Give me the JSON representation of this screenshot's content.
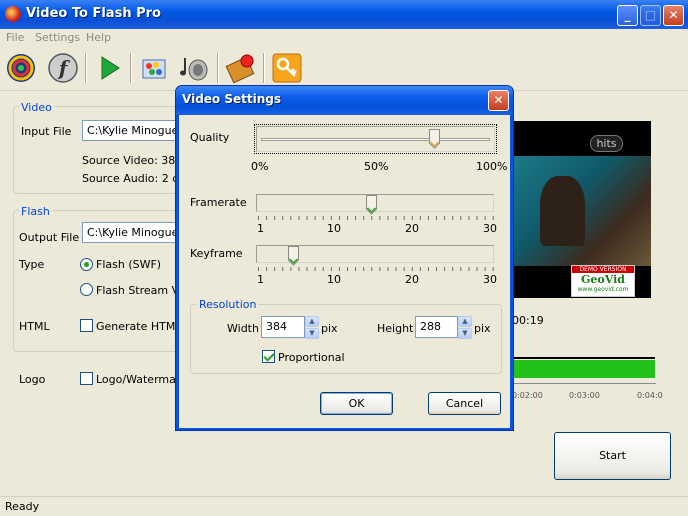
{
  "app": {
    "title": "Video To Flash Pro"
  },
  "menu": [
    "File",
    "Settings",
    "Help"
  ],
  "toolbar": {
    "icons": [
      "open-video-icon",
      "flash-icon",
      "play-icon",
      "color-palette-icon",
      "audio-speaker-icon",
      "film-effects-icon",
      "key-register-icon"
    ]
  },
  "video_group": {
    "label": "Video",
    "input_file_label": "Input File",
    "input_file_value": "C:\\Kylie Minogue -",
    "source_video": "Source Video: 384x",
    "source_audio": "Source Audio: 2 cha"
  },
  "flash_group": {
    "label": "Flash",
    "output_file_label": "Output File",
    "output_file_value": "C:\\Kylie Minogue -",
    "type_label": "Type",
    "type_options": [
      "Flash (SWF)",
      "Flash Stream Vid"
    ],
    "type_selected": 0,
    "html_label": "HTML",
    "generate_html": "Generate HTML",
    "generate_html_checked": false
  },
  "logo": {
    "label": "Logo",
    "checkbox_label": "Logo/Watermark",
    "checked": false
  },
  "preview": {
    "badge": "hits",
    "demo_text": "DEMO VERSION",
    "brand": "GeoVid",
    "url": "www.geovid.com",
    "time_readout": "00:19",
    "timeline_labels": [
      "0:02:00",
      "0:03:00",
      "0:04:0"
    ]
  },
  "start_button": "Start",
  "status": "Ready",
  "dialog": {
    "title": "Video Settings",
    "quality": {
      "label": "Quality",
      "ticks": [
        "0%",
        "50%",
        "100%"
      ],
      "value_fraction": 0.77
    },
    "framerate": {
      "label": "Framerate",
      "ticks": [
        "1",
        "10",
        "20",
        "30"
      ],
      "value": 15,
      "min": 1,
      "max": 30
    },
    "keyframe": {
      "label": "Keyframe",
      "ticks": [
        "1",
        "10",
        "20",
        "30"
      ],
      "value": 5,
      "min": 1,
      "max": 30
    },
    "resolution": {
      "label": "Resolution",
      "width_label": "Width",
      "width_value": "384",
      "height_label": "Height",
      "height_value": "288",
      "unit": "pix",
      "proportional_label": "Proportional",
      "proportional_checked": true
    },
    "ok": "OK",
    "cancel": "Cancel"
  },
  "colors": {
    "accent": "#0046d5",
    "title_blue": "#0058e6",
    "progress_green": "#22c21a"
  }
}
